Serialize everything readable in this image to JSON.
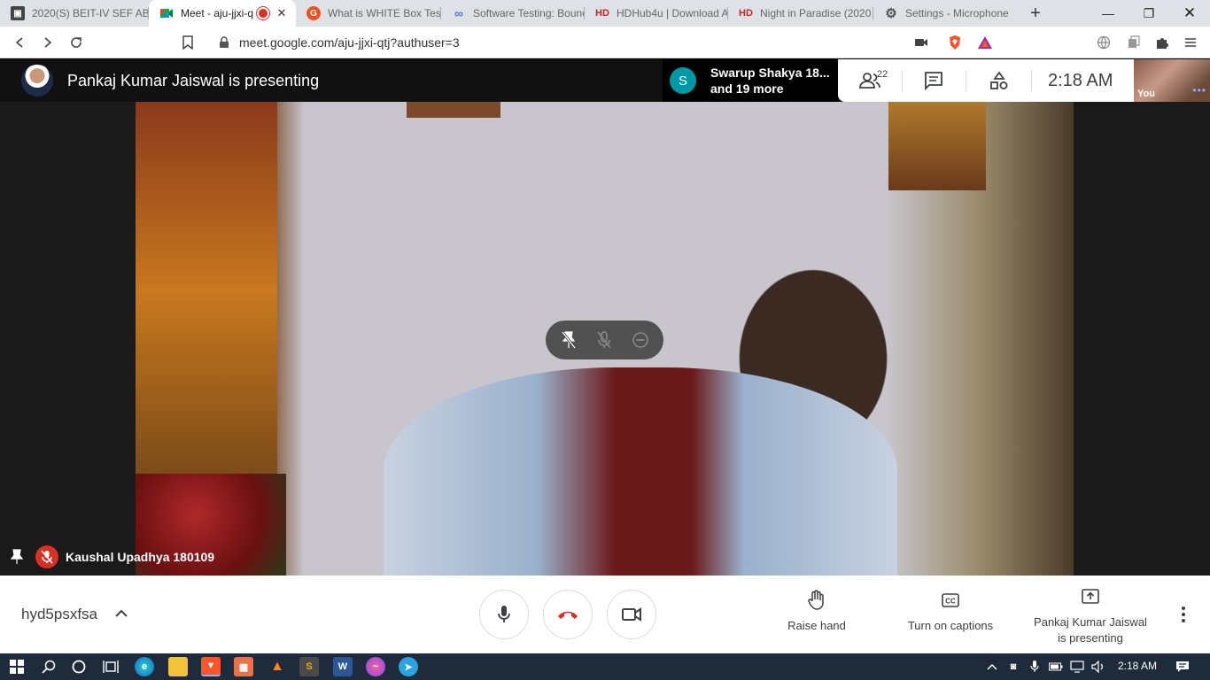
{
  "browser": {
    "tabs": [
      {
        "title": "2020(S) BEIT-IV SEF AB",
        "favicon": "classroom-icon",
        "active": false
      },
      {
        "title": "Meet - aju-jjxi-q",
        "favicon": "meet-icon",
        "active": true,
        "recording": true
      },
      {
        "title": "What is WHITE Box Test",
        "favicon": "guru99-icon",
        "active": false
      },
      {
        "title": "Software Testing: Bounc",
        "favicon": "link-icon",
        "active": false
      },
      {
        "title": "HDHub4u | Download A",
        "favicon": "hd-icon",
        "active": false
      },
      {
        "title": "Night in Paradise (2020",
        "favicon": "hd-icon",
        "active": false
      },
      {
        "title": "Settings - Microphone",
        "favicon": "gear-icon",
        "active": false
      }
    ],
    "url": "meet.google.com/aju-jjxi-qtj?authuser=3"
  },
  "meet": {
    "presenter_banner": "Pankaj Kumar Jaiswal is presenting",
    "participants_chip": {
      "avatar_letter": "S",
      "line1": "Swarup Shakya 18...",
      "line2": "and 19 more"
    },
    "people_count": "22",
    "clock": "2:18  AM",
    "self_label": "You",
    "tile_name": "Kaushal Upadhya 180109",
    "meeting_code": "hyd5psxfsa",
    "actions": {
      "raise_hand": "Raise hand",
      "captions": "Turn on captions",
      "presenting_line1": "Pankaj Kumar Jaiswal",
      "presenting_line2": "is presenting"
    }
  },
  "taskbar": {
    "clock": "2:18 AM",
    "apps": [
      "start-icon",
      "search-icon",
      "cortana-icon",
      "task-view-icon",
      "edge-icon",
      "file-explorer-icon",
      "brave-icon",
      "app-icon",
      "vlc-icon",
      "sublime-icon",
      "word-icon",
      "messenger-icon",
      "telegram-icon"
    ]
  },
  "colors": {
    "accent_red": "#d93025",
    "meet_teal": "#0097a7",
    "taskbar": "#1f2a3a"
  }
}
